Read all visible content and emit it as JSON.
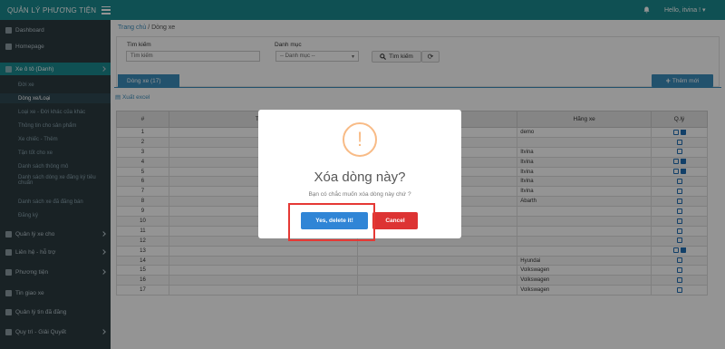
{
  "app": {
    "title": "QUẢN LÝ PHƯƠNG TIỆN",
    "user_greeting": "Hello, itvina ! ▾"
  },
  "sidebar": {
    "items": [
      {
        "label": "Dashboard"
      },
      {
        "label": "Homepage"
      },
      {
        "label": "Xe ô tô (Danh)"
      },
      {
        "label": "Đời xe"
      },
      {
        "label": "Dòng xe/Loại"
      },
      {
        "label": "Loại xe - Đời khác của khác"
      },
      {
        "label": "Thông tin cho sản phẩm"
      },
      {
        "label": "Xe chiếc - Thêm"
      },
      {
        "label": "Tận tốt cho xe"
      },
      {
        "label": "Danh sách thông mô"
      },
      {
        "label": "Danh sách dòng xe đăng ký tiêu chuẩn"
      },
      {
        "label": "Danh sách xe đã đăng bán"
      },
      {
        "label": "Đăng ký"
      },
      {
        "label": "Quản lý xe cho"
      },
      {
        "label": "Liên hệ - hỗ trợ"
      },
      {
        "label": "Phương tiện"
      },
      {
        "label": "Tin giao xe"
      },
      {
        "label": "Quản lý tin đã đăng"
      },
      {
        "label": "Quy trì - Giải Quyết"
      }
    ]
  },
  "breadcrumb": {
    "home": "Trang chủ",
    "sep": "/",
    "current": "Dòng xe"
  },
  "filters": {
    "search_label": "Tìm kiếm",
    "search_placeholder": "Tìm kiếm",
    "category_label": "Danh mục",
    "category_value": "-- Danh mục --",
    "search_button": "Tìm kiếm",
    "refresh_icon": "⟳"
  },
  "tab": {
    "label": "Dòng xe (17)"
  },
  "add_button": "Thêm mới",
  "export_link": "Xuất excel",
  "table": {
    "headers": [
      "#",
      "Tên d",
      "",
      "Hãng xe",
      "Q.lý"
    ],
    "rows": [
      {
        "num": "1",
        "name": "",
        "extra": "",
        "brand": "demo",
        "del": true
      },
      {
        "num": "2",
        "name": "",
        "extra": "",
        "brand": "",
        "del": false
      },
      {
        "num": "3",
        "name": "",
        "extra": "",
        "brand": "Itvina",
        "del": false
      },
      {
        "num": "4",
        "name": "",
        "extra": "",
        "brand": "Itvina",
        "del": true
      },
      {
        "num": "5",
        "name": "",
        "extra": "",
        "brand": "Itvina",
        "del": true
      },
      {
        "num": "6",
        "name": "",
        "extra": "",
        "brand": "Itvina",
        "del": false
      },
      {
        "num": "7",
        "name": "",
        "extra": "",
        "brand": "Itvina",
        "del": false
      },
      {
        "num": "8",
        "name": "",
        "extra": "",
        "brand": "Abarth",
        "del": false
      },
      {
        "num": "9",
        "name": "",
        "extra": "",
        "brand": "",
        "del": false
      },
      {
        "num": "10",
        "name": "",
        "extra": "",
        "brand": "",
        "del": false
      },
      {
        "num": "11",
        "name": "",
        "extra": "",
        "brand": "",
        "del": false
      },
      {
        "num": "12",
        "name": "",
        "extra": "",
        "brand": "",
        "del": false
      },
      {
        "num": "13",
        "name": "",
        "extra": "",
        "brand": "",
        "del": true
      },
      {
        "num": "14",
        "name": "",
        "extra": "",
        "brand": "Hyundai",
        "del": false
      },
      {
        "num": "15",
        "name": "",
        "extra": "",
        "brand": "Volkswagen",
        "del": false
      },
      {
        "num": "16",
        "name": "",
        "extra": "",
        "brand": "Volkswagen",
        "del": false
      },
      {
        "num": "17",
        "name": "",
        "extra": "",
        "brand": "Volkswagen",
        "del": false
      }
    ]
  },
  "modal": {
    "icon": "!",
    "title": "Xóa dòng này?",
    "text": "Bạn có chắc muốn xóa dòng này chứ ?",
    "confirm": "Yes, delete it!",
    "cancel": "Cancel"
  },
  "colors": {
    "topbar": "#1a8a8f",
    "primary": "#3c8dbc",
    "confirm": "#3085d6",
    "cancel": "#dd3333",
    "warning": "#f8bb86",
    "highlight": "#e53935"
  }
}
